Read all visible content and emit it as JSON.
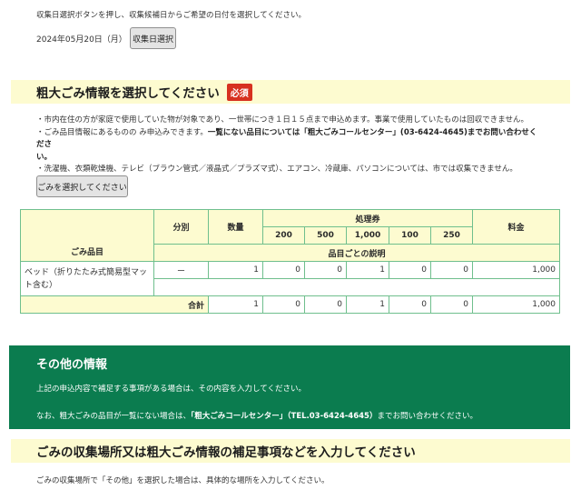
{
  "intro": {
    "instruction": "収集日選択ボタンを押し、収集候補日からご希望の日付を選択してください。",
    "selected_date": "2024年05月20日（月）",
    "date_button": "収集日選択"
  },
  "garbage_section": {
    "title": "粗大ごみ情報を選択してください",
    "badge": "必須",
    "bullet1": "・市内在住の方が家庭で使用していた物が対象であり、一世帯につき１日１５点まで申込めます。事業で使用していたものは回収できません。",
    "bullet2_prefix": "・ごみ品目情報にあるものの み申込みできます。",
    "bullet2_bold": "一覧にない品目については「粗大ごみコールセンター」(03-6424-4645)までお問い合わせくださ",
    "bullet2_bold_cont": "い。",
    "bullet3": "・洗濯機、衣類乾燥機、テレビ（ブラウン管式／液晶式／プラズマ式）、エアコン、冷蔵庫、パソコンについては、市では収集できません。",
    "select_button": "ごみを選択してください"
  },
  "table": {
    "col_item": "ごみ品目",
    "col_category": "分別",
    "col_quantity": "数量",
    "col_tickets": "処理券",
    "ticket_types": [
      "200",
      "500",
      "1,000",
      "100",
      "250"
    ],
    "col_fee": "料金",
    "item_desc_header": "品目ごとの説明",
    "rows": [
      {
        "item": "ベッド（折りたたみ式簡易型マット含む）",
        "category": "ー",
        "quantity": "1",
        "tickets": [
          "0",
          "0",
          "1",
          "0",
          "0"
        ],
        "fee": "1,000"
      }
    ],
    "total_label": "合計",
    "total_quantity": "1",
    "total_tickets": [
      "0",
      "0",
      "1",
      "0",
      "0"
    ],
    "total_fee": "1,000"
  },
  "other_info": {
    "title": "その他の情報",
    "line1": "上記の申込内容で補足する事項がある場合は、その内容を入力してください。",
    "line2_prefix": "なお、粗大ごみの品目が一覧にない場合は、",
    "line2_bold": "「粗大ごみコールセンター」（TEL.03-6424-4645）",
    "line2_suffix": "までお問い合わせください。"
  },
  "supplement_section": {
    "title": "ごみの収集場所又は粗大ごみ情報の補足事項などを入力してください",
    "note": "ごみの収集場所で「その他」を選択した場合は、具体的な場所を入力してください。"
  }
}
